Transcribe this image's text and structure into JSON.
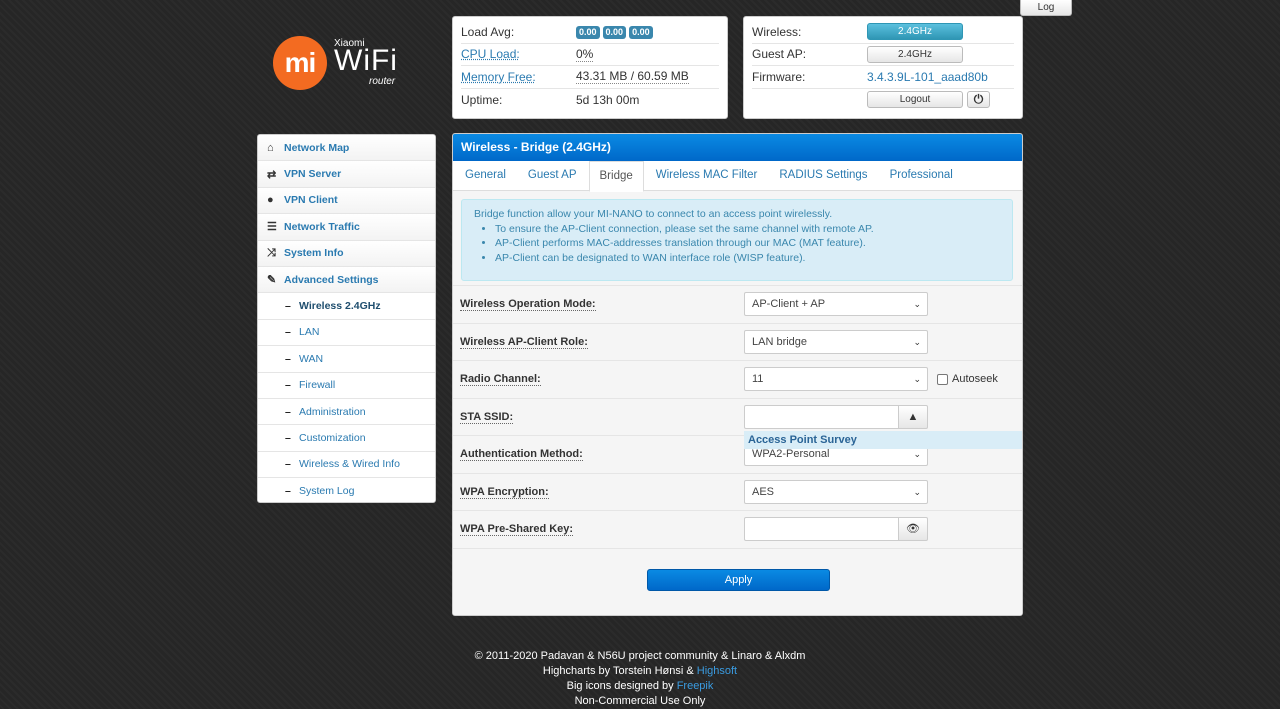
{
  "log_tab": "Log",
  "logo": {
    "badge": "mi",
    "brand": "Xiaomi",
    "name": "WiFi",
    "sub": "router"
  },
  "status_left": {
    "load_avg_label": "Load Avg:",
    "load_avg": [
      "0.00",
      "0.00",
      "0.00"
    ],
    "cpu_label": "CPU Load:",
    "cpu_value": "0%",
    "mem_label": "Memory Free:",
    "mem_value": "43.31 MB / 60.59 MB",
    "uptime_label": "Uptime:",
    "uptime_value": "5d 13h 00m"
  },
  "status_right": {
    "wireless_label": "Wireless:",
    "wireless_btn": "2.4GHz",
    "guest_label": "Guest AP:",
    "guest_btn": "2.4GHz",
    "firmware_label": "Firmware:",
    "firmware_value": "3.4.3.9L-101_aaad80b",
    "logout": "Logout",
    "power_icon": "power-icon"
  },
  "sidebar": {
    "items": [
      {
        "label": "Network Map",
        "icon": "home-icon"
      },
      {
        "label": "VPN Server",
        "icon": "retweet-icon"
      },
      {
        "label": "VPN Client",
        "icon": "globe-icon"
      },
      {
        "label": "Network Traffic",
        "icon": "list-icon"
      },
      {
        "label": "System Info",
        "icon": "random-icon"
      },
      {
        "label": "Advanced Settings",
        "icon": "wrench-icon"
      }
    ],
    "sub_items": [
      "Wireless 2.4GHz",
      "LAN",
      "WAN",
      "Firewall",
      "Administration",
      "Customization",
      "Wireless & Wired Info",
      "System Log"
    ]
  },
  "main": {
    "title": "Wireless - Bridge (2.4GHz)",
    "tabs": [
      "General",
      "Guest AP",
      "Bridge",
      "Wireless MAC Filter",
      "RADIUS Settings",
      "Professional"
    ],
    "active_tab": "Bridge",
    "alert": {
      "intro": "Bridge function allow your MI-NANO to connect to an access point wirelessly.",
      "bullets": [
        "To ensure the AP-Client connection, please set the same channel with remote AP.",
        "AP-Client performs MAC-addresses translation through our MAC (MAT feature).",
        "AP-Client can be designated to WAN interface role (WISP feature)."
      ]
    },
    "form": {
      "op_mode_label": "Wireless Operation Mode:",
      "op_mode_value": "AP-Client + AP",
      "role_label": "Wireless AP-Client Role:",
      "role_value": "LAN bridge",
      "channel_label": "Radio Channel:",
      "channel_value": "11",
      "autoseek_label": "Autoseek",
      "ssid_label": "STA SSID:",
      "ssid_value": "",
      "survey_label": "Access Point Survey",
      "auth_label": "Authentication Method:",
      "auth_value": "WPA2-Personal",
      "enc_label": "WPA Encryption:",
      "enc_value": "AES",
      "psk_label": "WPA Pre-Shared Key:",
      "psk_value": ""
    },
    "apply": "Apply"
  },
  "footer": {
    "line1": "© 2011-2020 Padavan & N56U project community & Linaro & Alxdm",
    "line2_prefix": "Highcharts by Torstein Hønsi & ",
    "line2_link": "Highsoft",
    "line3_prefix": "Big icons designed by ",
    "line3_link": "Freepik",
    "line4": "Non-Commercial Use Only"
  }
}
